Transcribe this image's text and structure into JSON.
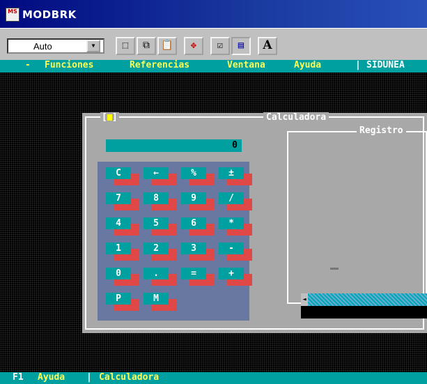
{
  "window_title": "MODBRK",
  "title_icon_text": "MS",
  "toolbar": {
    "font_select": "Auto",
    "buttons": [
      {
        "name": "mark-icon",
        "glyph": "⬚"
      },
      {
        "name": "copy-icon",
        "glyph": "⧉"
      },
      {
        "name": "paste-icon",
        "glyph": "📋"
      },
      {
        "name": "fullscreen-icon",
        "glyph": "✥"
      },
      {
        "name": "properties-icon",
        "glyph": "☑"
      },
      {
        "name": "background-icon",
        "glyph": "▤"
      },
      {
        "name": "font-icon",
        "glyph": "A"
      }
    ]
  },
  "menu": {
    "system": "-",
    "items": [
      "Funciones",
      "Referencias",
      "Ventana",
      "Ayuda"
    ],
    "separator": "|",
    "app": "SIDUNEA"
  },
  "calculator": {
    "title": "Calculadora",
    "close_left": "[",
    "close_right": "]",
    "display_value": "0",
    "keys": [
      [
        "C",
        "←",
        "%",
        "±"
      ],
      [
        "7",
        "8",
        "9",
        "/"
      ],
      [
        "4",
        "5",
        "6",
        "*"
      ],
      [
        "1",
        "2",
        "3",
        "-"
      ],
      [
        "0",
        ".",
        "=",
        "+"
      ],
      [
        "P",
        "M"
      ]
    ],
    "register_title": "Registro",
    "register_entry": "-",
    "scroll_left": "◄"
  },
  "status": {
    "key": "F1",
    "help": "Ayuda",
    "separator": "|",
    "context": "Calculadora"
  },
  "colors": {
    "accent_cyan": "#00a0a0",
    "menu_text": "#ffff55",
    "key_shadow": "#e04848",
    "keypad_bg": "#6878a0",
    "window_bg": "#a8a8a8"
  }
}
